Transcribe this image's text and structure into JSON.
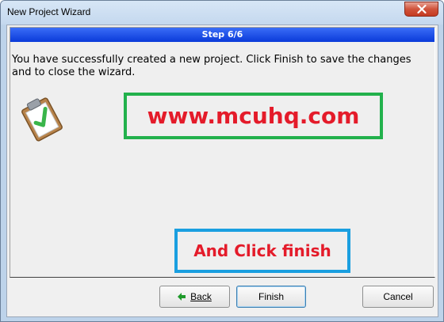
{
  "window": {
    "title": "New Project Wizard"
  },
  "wizard": {
    "step_label": "Step 6/6",
    "message": "You have successfully created a new project. Click Finish to save the changes and to close the wizard."
  },
  "overlays": {
    "url_text": "www.mcuhq.com",
    "instruction_text": "And Click finish"
  },
  "buttons": {
    "back_label": "Back",
    "finish_label": "Finish",
    "cancel_label": "Cancel"
  },
  "colors": {
    "step_bar": "#0a3ad9",
    "url_box_border": "#22b14c",
    "instruction_box_border": "#1a9fe0",
    "overlay_text": "#e41b2a",
    "back_arrow": "#1e9a2a"
  }
}
